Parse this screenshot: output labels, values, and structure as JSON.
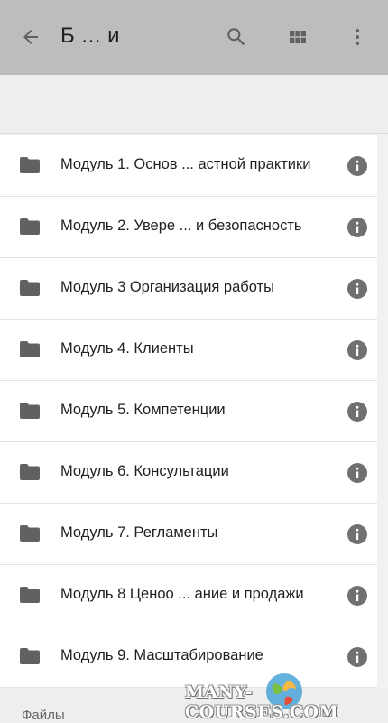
{
  "header": {
    "title": "Б ... и",
    "back_icon": "arrow-back-icon",
    "search_icon": "search-icon",
    "view_icon": "grid-view-icon",
    "more_icon": "more-vert-icon"
  },
  "folders": [
    {
      "label": "Модуль 1. Основ ... астной практики"
    },
    {
      "label": "Модуль 2. Увере ... и безопасность"
    },
    {
      "label": "Модуль 3 Организация работы"
    },
    {
      "label": "Модуль 4. Клиенты"
    },
    {
      "label": "Модуль 5. Компетенции"
    },
    {
      "label": "Модуль 6. Консультации"
    },
    {
      "label": "Модуль 7. Регламенты"
    },
    {
      "label": "Модуль 8 Ценоо ... ание и продажи"
    },
    {
      "label": "Модуль 9. Масштабирование"
    }
  ],
  "files_section": {
    "label": "Файлы"
  },
  "watermark": {
    "text": "MANY-COURSES.COM"
  },
  "colors": {
    "appbar": "#bdbdbd",
    "icon": "#616161",
    "info": "#707070"
  }
}
